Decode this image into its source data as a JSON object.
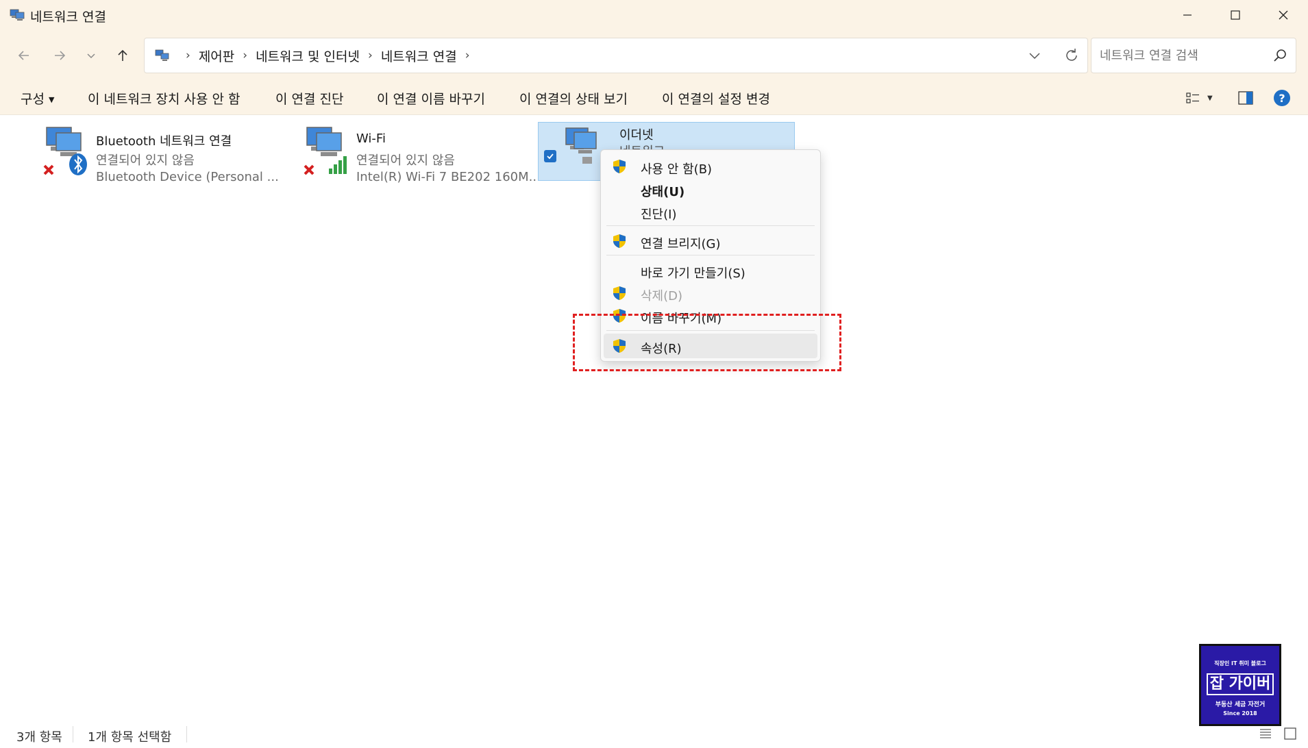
{
  "window": {
    "title": "네트워크 연결"
  },
  "nav": {
    "breadcrumbs": [
      "제어판",
      "네트워크 및 인터넷",
      "네트워크 연결"
    ],
    "search_placeholder": "네트워크 연결 검색"
  },
  "commands": {
    "organize": "구성",
    "disable_device": "이 네트워크 장치 사용 안 함",
    "diagnose": "이 연결 진단",
    "rename": "이 연결 이름 바꾸기",
    "view_status": "이 연결의 상태 보기",
    "change_settings": "이 연결의 설정 변경"
  },
  "connections": [
    {
      "name": "Bluetooth 네트워크 연결",
      "status": "연결되어 있지 않음",
      "device": "Bluetooth Device (Personal ...",
      "selected": false,
      "connected": false
    },
    {
      "name": "Wi-Fi",
      "status": "연결되어 있지 않음",
      "device": "Intel(R) Wi-Fi 7 BE202 160M...",
      "selected": false,
      "connected": false
    },
    {
      "name": "이더넷",
      "status": "네트워크",
      "device": "",
      "selected": true,
      "connected": true
    }
  ],
  "context_menu": {
    "items": [
      {
        "label": "사용 안 함(B)",
        "shield": true,
        "bold": false,
        "disabled": false
      },
      {
        "label": "상태(U)",
        "shield": false,
        "bold": true,
        "disabled": false
      },
      {
        "label": "진단(I)",
        "shield": false,
        "bold": false,
        "disabled": false
      },
      {
        "label": "연결 브리지(G)",
        "shield": true,
        "bold": false,
        "disabled": false
      },
      {
        "label": "바로 가기 만들기(S)",
        "shield": false,
        "bold": false,
        "disabled": false
      },
      {
        "label": "삭제(D)",
        "shield": true,
        "bold": false,
        "disabled": true
      },
      {
        "label": "이름 바꾸기(M)",
        "shield": true,
        "bold": false,
        "disabled": false
      },
      {
        "label": "속성(R)",
        "shield": true,
        "bold": false,
        "disabled": false,
        "highlighted": true
      }
    ]
  },
  "statusbar": {
    "item_count": "3개 항목",
    "selected_count": "1개 항목 선택함"
  },
  "watermark": {
    "line1": "직장인 IT 취미 블로그",
    "line2": "잡 가이버",
    "line3": "부동산 세금 자전거",
    "line4": "Since 2018"
  },
  "colors": {
    "chrome_bg": "#fbf3e6",
    "selection_bg": "#cce4f7",
    "accent": "#1f6fc5",
    "highlight_border": "#e02020",
    "logo_bg": "#2a1aa6"
  }
}
